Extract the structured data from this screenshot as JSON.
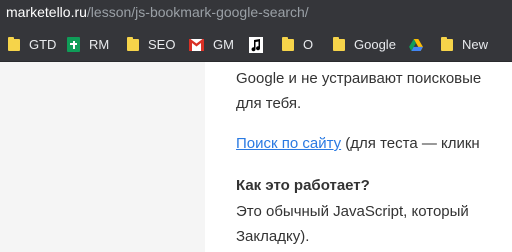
{
  "address_bar": {
    "host": "marketello.ru",
    "path": "/lesson/js-bookmark-google-search/"
  },
  "bookmarks": [
    {
      "label": "GTD",
      "icon": "folder-icon"
    },
    {
      "label": "RM",
      "icon": "google-sheets-icon"
    },
    {
      "label": "SEO",
      "icon": "folder-icon"
    },
    {
      "label": "GM",
      "icon": "gmail-icon"
    },
    {
      "label": "",
      "icon": "music-note-icon"
    },
    {
      "label": "O",
      "icon": "folder-icon"
    },
    {
      "label": "Google",
      "icon": "folder-icon"
    },
    {
      "label": "",
      "icon": "google-drive-icon"
    },
    {
      "label": "New",
      "icon": "folder-icon"
    }
  ],
  "article": {
    "line1": "Google и не устраивают поисковые",
    "line2": "для тебя.",
    "link_text": "Поиск по сайту",
    "link_tail": " (для теста — кликн",
    "heading": "Как это работает?",
    "line5": "Это обычный JavaScript, который",
    "line6": "Закладку)."
  },
  "colors": {
    "toolbar_bg": "#35363a",
    "link": "#2a7ae2",
    "folder": "#f6d44a"
  }
}
